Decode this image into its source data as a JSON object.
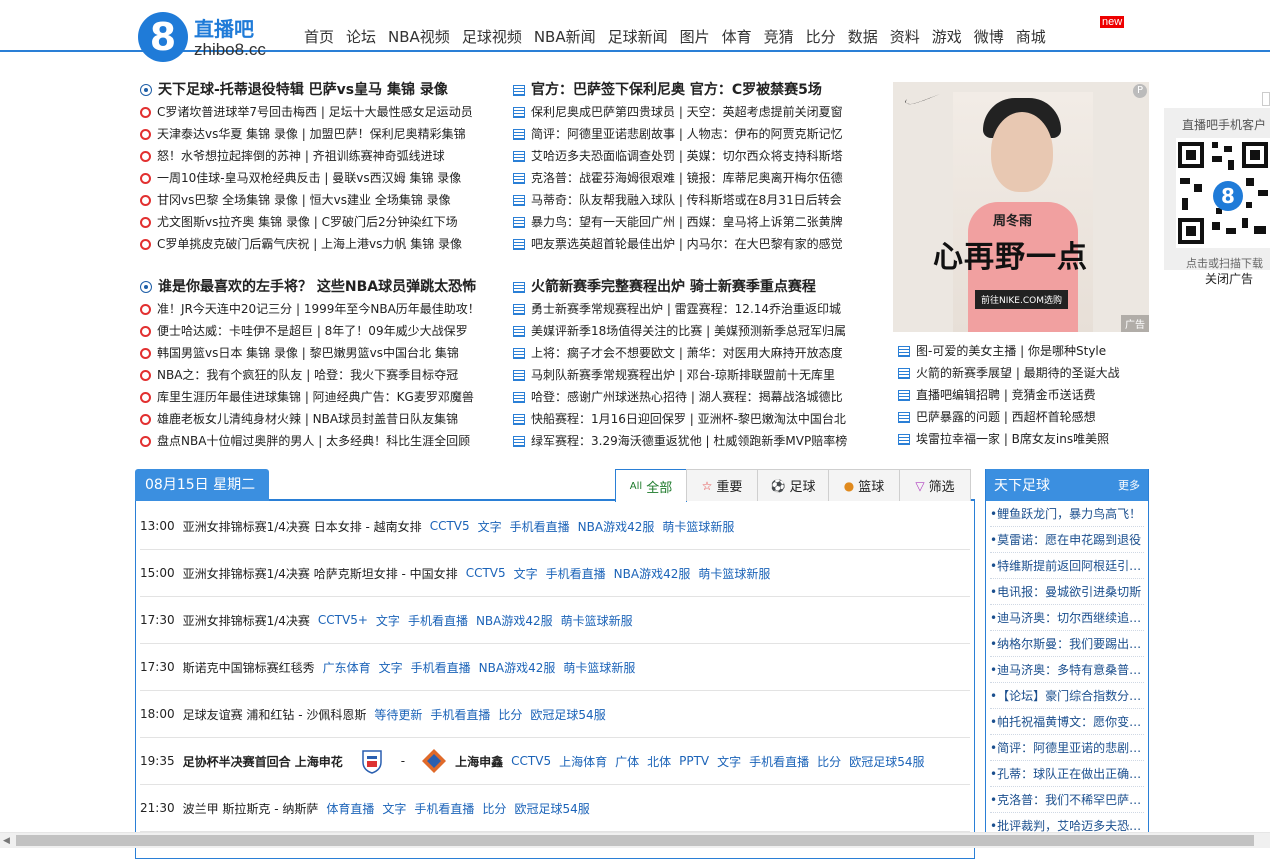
{
  "brand": {
    "logo_digit": "8",
    "name_cn": "直播吧",
    "domain": "zhibo8.cc"
  },
  "nav": [
    "首页",
    "论坛",
    "NBA视频",
    "足球视频",
    "NBA新闻",
    "足球新闻",
    "图片",
    "体育",
    "竞猜",
    "比分",
    "数据",
    "资料",
    "游戏",
    "微博",
    "商城"
  ],
  "nav_badge": "new",
  "football_block": {
    "headline": "天下足球-托蒂退役特辑 巴萨vs皇马 集锦 录像",
    "items": [
      "C罗诸坎普进球举7号回击梅西 | 足坛十大最性感女足运动员",
      "天津泰达vs华夏 集锦 录像 | 加盟巴萨！保利尼奥精彩集锦",
      "怒！水爷想拉起摔倒的苏神 | 齐祖训练赛神奇弧线进球",
      "一周10佳球-皇马双枪经典反击 | 曼联vs西汉姆 集锦 录像",
      "甘冈vs巴黎 全场集锦 录像 | 恒大vs建业 全场集锦 录像",
      "尤文图斯vs拉齐奥 集锦 录像 | C罗破门后2分钟染红下场",
      "C罗单挑皮克破门后霸气庆祝 | 上海上港vs力帆 集锦 录像"
    ]
  },
  "official_block": {
    "headline": "官方：巴萨签下保利尼奥 官方：C罗被禁赛5场",
    "items": [
      "保利尼奥成巴萨第四贵球员 | 天空：英超考虑提前关闭夏窗",
      "简评：阿德里亚诺悲剧故事 | 人物志：伊布的阿贾克斯记忆",
      "艾哈迈多夫恐面临调查处罚 | 英媒：切尔西众将支持科斯塔",
      "克洛普：战霍芬海姆很艰难 | 镜报：库蒂尼奥离开梅尔伍德",
      "马蒂奇：队友帮我融入球队 | 传科斯塔或在8月31日后转会",
      "暴力鸟：望有一天能回广州 | 西媒：皇马将上诉第二张黄牌",
      "吧友票选英超首轮最佳出炉 | 内马尔：在大巴黎有家的感觉"
    ]
  },
  "nba_block": {
    "headline": "谁是你最喜欢的左手将？ 这些NBA球员弹跳太恐怖",
    "items": [
      "准！JR今天连中20记三分 | 1999年至今NBA历年最佳助攻！",
      "便士哈达威：卡哇伊不是超巨 | 8年了！09年威少大战保罗",
      "韩国男篮vs日本 集锦 录像 | 黎巴嫩男篮vs中国台北 集锦",
      "NBA之：我有个疯狂的队友 | 哈登：我火下赛季目标夺冠",
      "库里生涯历年最佳进球集锦 | 阿迪经典广告：KG麦罗邓魔兽",
      "雄鹿老板女儿清纯身材火辣 | NBA球员封盖昔日队友集锦",
      "盘点NBA十位帽过奥胖的男人 | 太多经典！科比生涯全回顾"
    ]
  },
  "rockets_block": {
    "headline": "火箭新赛季完整赛程出炉 骑士新赛季重点赛程",
    "items": [
      "勇士新赛季常规赛程出炉 | 雷霆赛程：12.14乔治重返印城",
      "美媒评新季18场值得关注的比赛 | 美媒预测新季总冠军归属",
      "上将：瘸子才会不想要欧文 | 萧华：对医用大麻持开放态度",
      "马刺队新赛季常规赛程出炉 | 邓台-琼斯排联盟前十无库里",
      "哈登：感谢广州球迷热心招待 | 湖人赛程：揭幕战洛城德比",
      "快船赛程：1月16日迎回保罗 | 亚洲杯-黎巴嫩淘汰中国台北",
      "绿军赛程：3.29海沃德重返犹他 | 杜威领跑新季MVP赔率榜"
    ]
  },
  "ad_block": {
    "name": "周冬雨",
    "slogan": "心再野一点",
    "button": "前往NIKE.COM选购",
    "tag": "广告",
    "items": [
      "图-可爱的美女主播 | 你是哪种Style",
      "火箭的新赛季展望 | 最期待的圣诞大战",
      "直播吧编辑招聘 | 竞猜金币送话费",
      "巴萨暴露的问题 | 西超杯首轮感想",
      "埃雷拉幸福一家 | B席女友ins唯美照"
    ]
  },
  "qr": {
    "title": "直播吧手机客户",
    "caption": "点击或扫描下载",
    "close": "关闭广告"
  },
  "schedule": {
    "date": "08月15日 星期二",
    "tabs": [
      "全部",
      "重要",
      "足球",
      "篮球",
      "筛选"
    ],
    "rows": [
      {
        "time": "13:00",
        "match": "亚洲女排锦标赛1/4决赛 日本女排 - 越南女排",
        "links": [
          "CCTV5",
          "文字",
          "手机看直播",
          "NBA游戏42服",
          "萌卡篮球新服"
        ]
      },
      {
        "time": "15:00",
        "match": "亚洲女排锦标赛1/4决赛 哈萨克斯坦女排 - 中国女排",
        "links": [
          "CCTV5",
          "文字",
          "手机看直播",
          "NBA游戏42服",
          "萌卡篮球新服"
        ]
      },
      {
        "time": "17:30",
        "match": "亚洲女排锦标赛1/4决赛",
        "links": [
          "CCTV5+",
          "文字",
          "手机看直播",
          "NBA游戏42服",
          "萌卡篮球新服"
        ]
      },
      {
        "time": "17:30",
        "match": "斯诺克中国锦标赛红毯秀",
        "links": [
          "广东体育",
          "文字",
          "手机看直播",
          "NBA游戏42服",
          "萌卡篮球新服"
        ]
      },
      {
        "time": "18:00",
        "match": "足球友谊赛 浦和红钻 - 沙佩科恩斯",
        "links": [
          "等待更新",
          "手机看直播",
          "比分",
          "欧冠足球54服"
        ]
      },
      {
        "time": "19:35",
        "match": "足协杯半决赛首回合 上海申花",
        "vs": "-",
        "away": "上海申鑫",
        "links": [
          "CCTV5",
          "上海体育",
          "广体",
          "北体",
          "PPTV",
          "文字",
          "手机看直播",
          "比分",
          "欧冠足球54服"
        ]
      },
      {
        "time": "21:30",
        "match": "波兰甲 斯拉斯克 - 纳斯萨",
        "links": [
          "体育直播",
          "文字",
          "手机看直播",
          "比分",
          "欧冠足球54服"
        ]
      }
    ]
  },
  "sidebar": {
    "title": "天下足球",
    "more": "更多",
    "items": [
      "•鲤鱼跃龙门，暴力鸟高飞！",
      "•莫雷诺：愿在申花踢到退役",
      "•特维斯提前返回阿根廷引…",
      "•电讯报：曼城欲引进桑切斯",
      "•迪马济奥：切尔西继续追…",
      "•纳格尔斯曼：我们要踢出…",
      "•迪马济奥：多特有意桑普…",
      "•【论坛】豪门综合指数分…",
      "•帕托祝福黄博文：愿你变…",
      "•简评：阿德里亚诺的悲剧…",
      "•孔蒂：球队正在做出正确…",
      "•克洛普：我们不稀罕巴萨…",
      "•批评裁判，艾哈迈多夫恐…"
    ]
  },
  "colors": {
    "accent": "#2a7fd6",
    "tab_blue": "#3b8fe0",
    "link": "#1b63b8",
    "red": "#e23030"
  }
}
